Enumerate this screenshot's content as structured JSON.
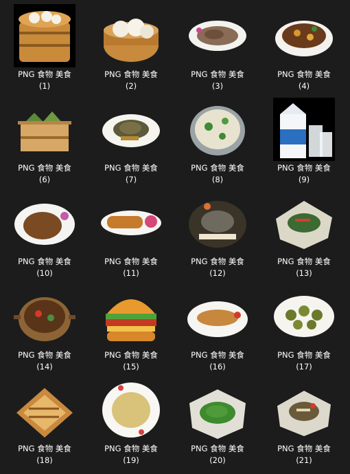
{
  "items": [
    {
      "name": "PNG 食物 美食",
      "index": "(1)",
      "icon": "steamer-icon"
    },
    {
      "name": "PNG 食物 美食",
      "index": "(2)",
      "icon": "bun-basket-icon"
    },
    {
      "name": "PNG 食物 美食",
      "index": "(3)",
      "icon": "meat-plate-icon"
    },
    {
      "name": "PNG 食物 美食",
      "index": "(4)",
      "icon": "braised-dish-icon"
    },
    {
      "name": "PNG 食物 美食",
      "index": "(6)",
      "icon": "zongzi-steamer-icon"
    },
    {
      "name": "PNG 食物 美食",
      "index": "(7)",
      "icon": "turtle-dish-icon"
    },
    {
      "name": "PNG 食物 美食",
      "index": "(8)",
      "icon": "soup-pot-icon"
    },
    {
      "name": "PNG 食物 美食",
      "index": "(9)",
      "icon": "milk-carton-icon"
    },
    {
      "name": "PNG 食物 美食",
      "index": "(10)",
      "icon": "fried-dish-icon"
    },
    {
      "name": "PNG 食物 美食",
      "index": "(11)",
      "icon": "roll-plate-icon"
    },
    {
      "name": "PNG 食物 美食",
      "index": "(12)",
      "icon": "fish-platter-icon"
    },
    {
      "name": "PNG 食物 美食",
      "index": "(13)",
      "icon": "salad-plate-icon"
    },
    {
      "name": "PNG 食物 美食",
      "index": "(14)",
      "icon": "stew-pot-icon"
    },
    {
      "name": "PNG 食物 美食",
      "index": "(15)",
      "icon": "burger-icon"
    },
    {
      "name": "PNG 食物 美食",
      "index": "(16)",
      "icon": "fish-plate-icon"
    },
    {
      "name": "PNG 食物 美食",
      "index": "(17)",
      "icon": "stuffed-dish-icon"
    },
    {
      "name": "PNG 食物 美食",
      "index": "(18)",
      "icon": "pastry-board-icon"
    },
    {
      "name": "PNG 食物 美食",
      "index": "(19)",
      "icon": "fried-rice-icon"
    },
    {
      "name": "PNG 食物 美食",
      "index": "(20)",
      "icon": "greens-plate-icon"
    },
    {
      "name": "PNG 食物 美食",
      "index": "(21)",
      "icon": "veggie-dish-icon"
    }
  ]
}
